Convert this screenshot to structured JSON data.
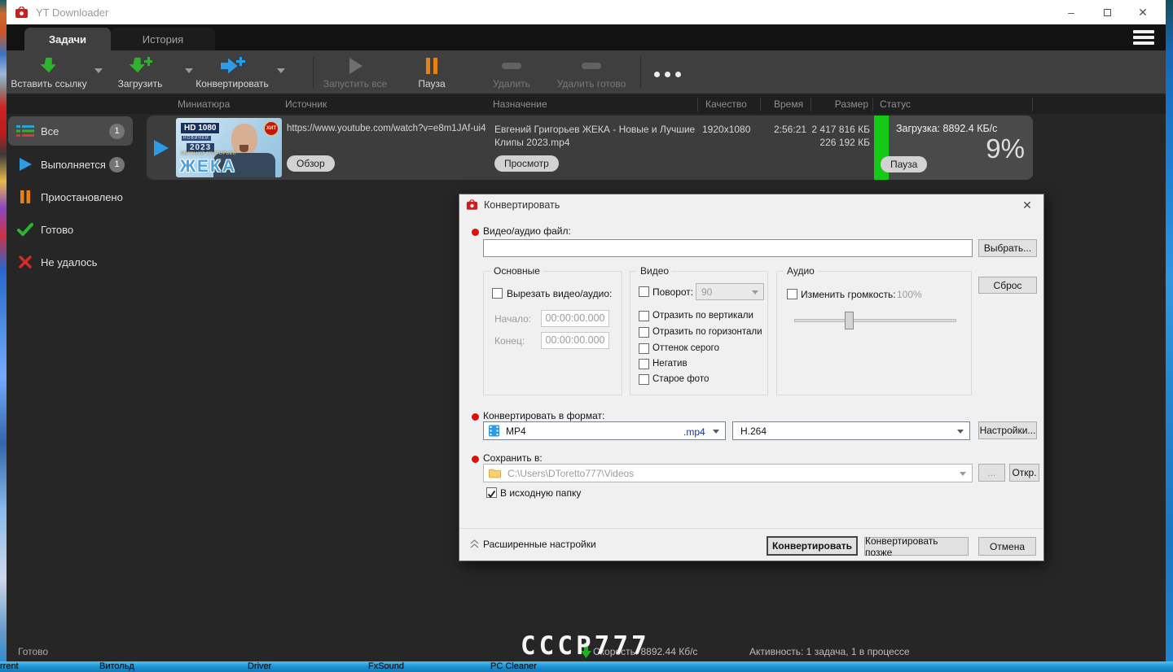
{
  "window": {
    "title": "YT Downloader"
  },
  "tabs": {
    "tasks": "Задачи",
    "history": "История"
  },
  "toolbar": {
    "paste_link": "Вставить ссылку",
    "download": "Загрузить",
    "convert": "Конвертировать",
    "start_all": "Запустить все",
    "pause": "Пауза",
    "delete": "Удалить",
    "delete_done": "Удалить готово"
  },
  "sidebar": {
    "items": [
      {
        "label": "Все",
        "count": "1"
      },
      {
        "label": "Выполняется",
        "count": "1"
      },
      {
        "label": "Приостановлено",
        "count": ""
      },
      {
        "label": "Готово",
        "count": ""
      },
      {
        "label": "Не удалось",
        "count": ""
      }
    ]
  },
  "table": {
    "headers": [
      "Миниатюра",
      "Источник",
      "Назначение",
      "Качество",
      "Время",
      "Размер",
      "Статус"
    ],
    "row": {
      "source_url": "https://www.youtube.com/watch?v=e8m1JAf-ui4",
      "source_button": "Обзор",
      "destination": "Евгений Григорьев ЖЕКА  - Новые и Лучшие Клипы 2023.mp4",
      "destination_button": "Просмотр",
      "quality": "1920x1080",
      "time": "2:56:21",
      "size_total": "2 417 816 КБ",
      "size_done": "226 192 КБ",
      "status_text": "Загрузка: 8892.4 КБ/с",
      "percent": "9%",
      "progress_percent": 9,
      "pause_button": "Пауза",
      "thumbnail": {
        "hd": "HD 1080",
        "sub": "НОВИНКИ",
        "year": "2023",
        "artist": "ЕВГЕНИЙ ГРИГОРЬЕВ",
        "name": "ЖЕКА",
        "hit": "ХИТ"
      }
    }
  },
  "statusbar": {
    "ready": "Готово",
    "watermark": "CCCP777",
    "speed": "Скорость: 8892.44 Кб/с",
    "activity": "Активность: 1 задача, 1 в процессе"
  },
  "dialog": {
    "title": "Конвертировать",
    "file_label": "Видео/аудио файл:",
    "file_value": "",
    "choose_button": "Выбрать...",
    "basic": {
      "title": "Основные",
      "cut_label": "Вырезать видео/аудио:",
      "start_label": "Начало:",
      "start_value": "00:00:00.000",
      "end_label": "Конец:",
      "end_value": "00:00:00.000"
    },
    "video": {
      "title": "Видео",
      "rotate_label": "Поворот:",
      "rotate_value": "90",
      "flip_v": "Отразить по вертикали",
      "flip_h": "Отразить по горизонтали",
      "grayscale": "Оттенок серого",
      "negative": "Негатив",
      "old_photo": "Старое фото"
    },
    "audio": {
      "title": "Аудио",
      "volume_label": "Изменить громкость:",
      "volume_value": "100%"
    },
    "reset_button": "Сброс",
    "format_label": "Конвертировать в формат:",
    "format_value": "MP4",
    "format_ext": ".mp4",
    "codec_value": "H.264",
    "settings_button": "Настройки...",
    "save_label": "Сохранить в:",
    "save_path": "C:\\Users\\DToretto777\\Videos",
    "browse_button": "...",
    "open_button": "Откр.",
    "same_folder_label": "В исходную папку",
    "advanced_label": "Расширенные настройки",
    "convert_button": "Конвертировать",
    "convert_later_button": "Конвертировать позже",
    "cancel_button": "Отмена"
  },
  "taskbar": {
    "items": [
      "rrent",
      "Витольд",
      "Driver",
      "FxSound",
      "PC Cleaner"
    ]
  },
  "colors": {
    "accent_green": "#2fb32f",
    "accent_blue": "#2e9be6",
    "accent_orange": "#e8820c",
    "progress_green": "#15ca15",
    "taskbar_blue": "#2196d9"
  }
}
